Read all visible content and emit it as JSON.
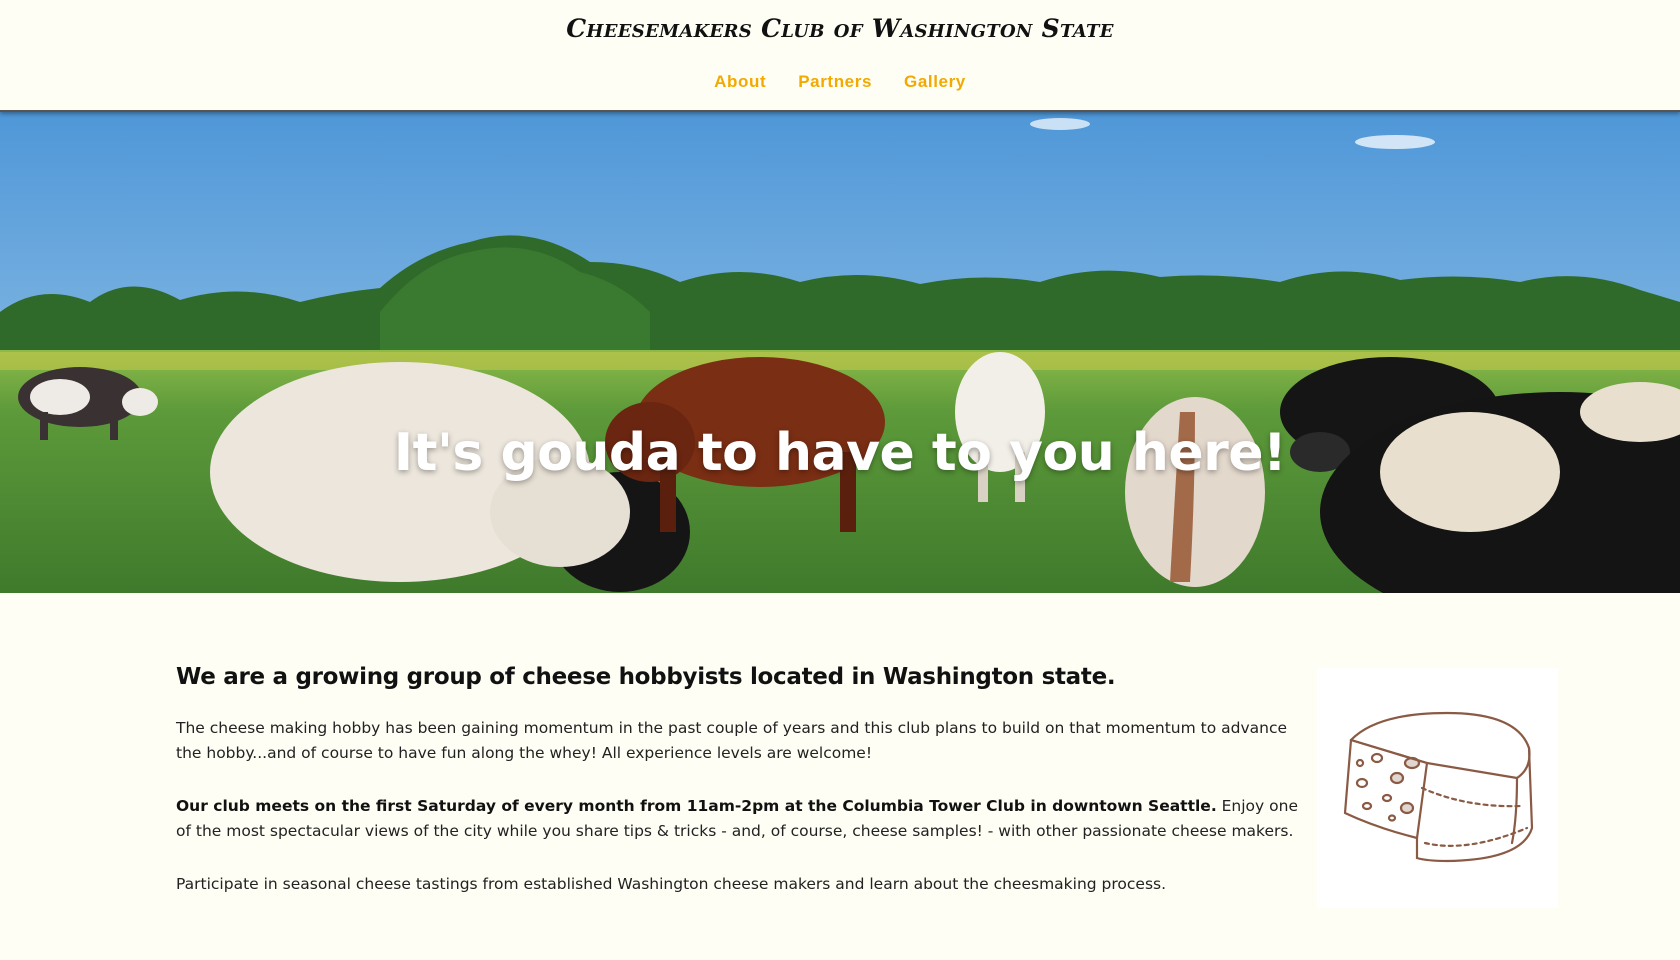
{
  "header": {
    "site_title": "Cheesemakers Club of Washington State",
    "nav": [
      {
        "label": "About"
      },
      {
        "label": "Partners"
      },
      {
        "label": "Gallery"
      }
    ]
  },
  "hero": {
    "title": "It's gouda to have to you here!"
  },
  "intro": {
    "heading": "We are a growing group of cheese hobbyists located in Washington state.",
    "paragraph1": "The cheese making hobby has been gaining momentum in the past couple of years and this club plans to build on that momentum to advance the hobby...and of course to have fun along the whey! All experience levels are welcome!",
    "paragraph2_bold": "Our club meets on the first Saturday of every month from 11am-2pm at the Columbia Tower Club in downtown Seattle.",
    "paragraph2_rest": " Enjoy one of the most spectacular views of the city while you share tips & tricks - and, of course, cheese samples! - with other passionate cheese makers.",
    "paragraph3": "Participate in seasonal cheese tastings from established Washington cheese makers and learn about the cheesmaking process."
  },
  "colors": {
    "accent": "#f2a900",
    "background": "#fefef5",
    "cheese_line": "#8a5a44"
  },
  "icons": [
    "cheese-wheel-icon"
  ]
}
